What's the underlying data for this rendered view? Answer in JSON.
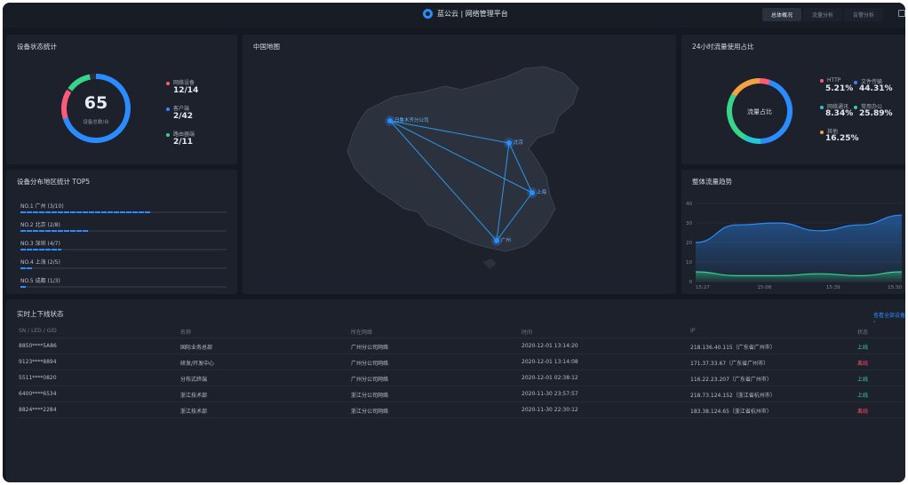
{
  "header": {
    "brand": "蓝公云 | 网络管理平台",
    "tabs": [
      {
        "label": "总体概况",
        "active": true
      },
      {
        "label": "流量分析",
        "active": false
      },
      {
        "label": "告警分析",
        "active": false
      }
    ]
  },
  "device_stats": {
    "title": "设备状态统计",
    "total": "65",
    "total_label": "设备总数/台",
    "items": [
      {
        "label": "网络设备",
        "value": "12/14",
        "color": "#ff5a7a"
      },
      {
        "label": "客户端",
        "value": "2/42",
        "color": "#2b8cff"
      },
      {
        "label": "路由器端",
        "value": "2/11",
        "color": "#37d48a"
      }
    ]
  },
  "region_top5": {
    "title": "设备分布地区统计 TOP5",
    "items": [
      {
        "label": "NO.1 广州 (3/10)",
        "ratio": 0.63
      },
      {
        "label": "NO.2 北京 (2/8)",
        "ratio": 0.33
      },
      {
        "label": "NO.3 深圳 (4/7)",
        "ratio": 0.2
      },
      {
        "label": "NO.4 上海 (2/5)",
        "ratio": 0.06
      },
      {
        "label": "NO.5 成都 (1/3)",
        "ratio": 0.03
      }
    ]
  },
  "china_map": {
    "title": "中国地图",
    "cities": [
      {
        "name": "乌鲁木齐分公司",
        "key": "urumqi"
      },
      {
        "name": "北京",
        "key": "beijing"
      },
      {
        "name": "上海",
        "key": "shanghai"
      },
      {
        "name": "广州",
        "key": "guangzhou"
      }
    ]
  },
  "traffic_share": {
    "title": "24小时流量使用占比",
    "center_label": "流量占比",
    "items": [
      {
        "label": "HTTP",
        "value": "5.21%",
        "color": "#ff5a7a"
      },
      {
        "label": "文件传输",
        "value": "44.31%",
        "color": "#2b8cff"
      },
      {
        "label": "网络通讯",
        "value": "8.34%",
        "color": "#22c6d6"
      },
      {
        "label": "常用办公",
        "value": "25.89%",
        "color": "#37d48a"
      },
      {
        "label": "其他",
        "value": "16.25%",
        "color": "#f5a340"
      }
    ]
  },
  "chart_data": {
    "type": "area",
    "title": "整体流量趋势",
    "x": [
      "15:27",
      "15:08",
      "15:39",
      "15:30"
    ],
    "ylim": [
      0,
      40
    ],
    "yticks": [
      "0",
      "10",
      "20",
      "30",
      "40"
    ],
    "grid": true,
    "series": [
      {
        "values": [
          20,
          29,
          30,
          26,
          29,
          34
        ],
        "color": "#2b8cff"
      },
      {
        "values": [
          5,
          3,
          3,
          4,
          3,
          5
        ],
        "color": "#37d48a"
      }
    ]
  },
  "device_table": {
    "title": "实时上下线状态",
    "more_label": "查看全部设备 ›",
    "columns": [
      "SN / LED / GID",
      "名称",
      "所在网络",
      "时间",
      "IP",
      "状态"
    ],
    "rows": [
      {
        "sn": "8850****5A86",
        "name": "国际业务总部",
        "network": "广州分公司网络",
        "time": "2020-12-01 13:14:20",
        "ip": "218.136.40.115（广东省广州市）",
        "status": "上线",
        "online": true
      },
      {
        "sn": "9123****8894",
        "name": "研发/开发中心",
        "network": "广州分公司网络",
        "time": "2020-12-01 13:14:08",
        "ip": "171.37.33.67（广东省广州市）",
        "status": "离线",
        "online": false
      },
      {
        "sn": "5511****0820",
        "name": "分布式终端",
        "network": "广州分公司网络",
        "time": "2020-12-01 02:38:12",
        "ip": "116.22.23.207（广东省广州市）",
        "status": "上线",
        "online": true
      },
      {
        "sn": "6400****6534",
        "name": "浙江技术部",
        "network": "浙江分公司网络",
        "time": "2020-11-30 23:57:57",
        "ip": "218.73.124.152（浙江省杭州市）",
        "status": "上线",
        "online": true
      },
      {
        "sn": "8824****2284",
        "name": "浙江技术部",
        "network": "浙江分公司网络",
        "time": "2020-11-30 22:30:12",
        "ip": "183.38.124.65（浙江省杭州市）",
        "status": "离线",
        "online": false
      }
    ]
  }
}
